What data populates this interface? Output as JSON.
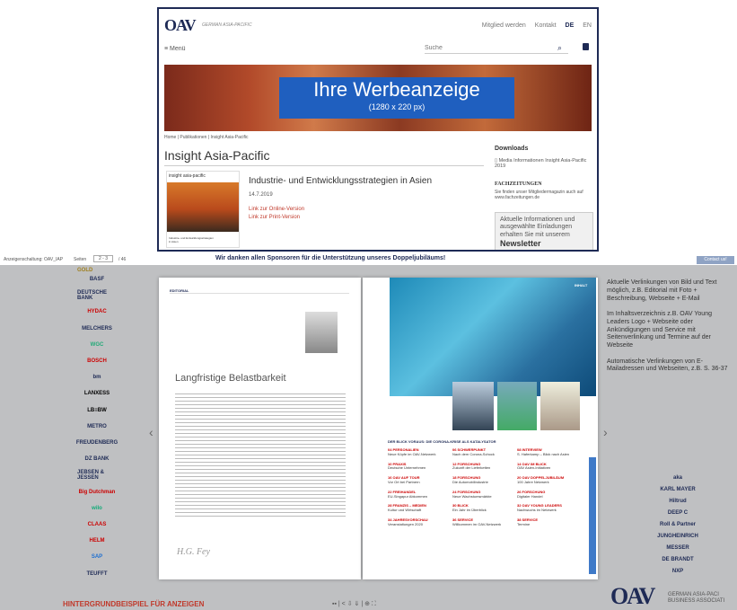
{
  "site": {
    "logo_text": "OAV",
    "logo_sub": "GERMAN ASIA-PACIFIC",
    "nav": [
      "Mitglied werden",
      "Kontakt",
      "DE",
      "EN"
    ],
    "menu_label": "Menü",
    "search_placeholder": "Suche",
    "banner_title": "Ihre Werbeanzeige",
    "banner_size": "(1280 x 220 px)",
    "breadcrumb": "Home | Publikationen | Insight Asia-Pacific",
    "page_title": "Insight Asia-Pacific",
    "cover_label": "insight asia-pacific",
    "cover_caption": "Industrie- und Entwicklungsstrategien in Asien",
    "article_title": "Industrie- und Entwicklungsstrategien in Asien",
    "article_date": "14.7.2019",
    "link_online": "Link zur Online-Version",
    "link_print": "Link zur Print-Version",
    "downloads_title": "Downloads",
    "download_item": "Media Informationen Insight Asia-Pacific 2019",
    "fach_logo": "FACHZEITUNGEN",
    "fach_text": "Sie finden unser Mitgliedermagazin auch auf www.fachzeitungen.de",
    "newsletter_text": "Aktuelle Informationen und ausgewählte Einladungen erhalten Sie mit unserem",
    "newsletter_title": "Newsletter"
  },
  "viewer": {
    "left_label": "Anzeigenschaltung: OAV_IAP",
    "pages_label": "Seiten",
    "page_current": "2 - 3",
    "page_total": "/ 46",
    "thanks": "Wir danken allen Sponsoren für die Unterstützung unseres Doppeljubiläums!",
    "contact_button": "Contact us!",
    "gold_label": "GOLD",
    "sponsors_left": [
      "BASF",
      "DEUTSCHE BANK",
      "HYDAC",
      "MELCHERS",
      "WGC",
      "BOSCH",
      "bm",
      "LANXESS",
      "LB≡BW",
      "METRO",
      "FREUDENBERG",
      "DZ BANK",
      "JEBSEN & JESSEN",
      "Big Dutchman",
      "wilo",
      "CLAAS",
      "HELM",
      "SAP",
      "TEUFFT"
    ],
    "sponsors_right": [
      "aka",
      "KARL MAYER",
      "Hiltrud",
      "DEEP C",
      "Roll & Partner",
      "JUNGHEINRICH",
      "MESSER",
      "DE BRANDT",
      "NXP"
    ],
    "editorial_label": "EDITORIAL",
    "editorial_title": "Langfristige Belastbarkeit",
    "inhalt_label": "INHALT",
    "toc_headline": "DER BLICK VORAUS: DIE CORONA-KRISE ALS KATALYSATOR",
    "toc": [
      [
        "04 PERSONALIEN",
        "Neue Köpfe im OAV-Netzwerk"
      ],
      [
        "06 SCHWERPUNKT",
        "Nach dem Corona-Schock"
      ],
      [
        "08 INTERVIEW",
        "S. Haferkamp – Blick nach Asien"
      ],
      [
        "10 PRAXIS",
        "Deutsche Unternehmen"
      ],
      [
        "12 FORSCHUNG",
        "Zukunft der Lieferketten"
      ],
      [
        "14 OAV IM BLICK",
        "OAV Asien-Initiativen"
      ],
      [
        "16 OAV AUF TOUR",
        "Vor Ort bei Partnern"
      ],
      [
        "18 FORSCHUNG",
        "Die Automobilindustrie"
      ],
      [
        "20 OAV DOPPELJUBILÄUM",
        "100 Jahre Netzwerk"
      ],
      [
        "22 FREIHANDEL",
        "EU-Singapur Abkommen"
      ],
      [
        "24 FORSCHUNG",
        "Neue Wachstumsmärkte"
      ],
      [
        "26 FORSCHUNG",
        "Digitaler Handel"
      ],
      [
        "28 FRANZIS – MEDIEN",
        "Kultur und Wirtschaft"
      ],
      [
        "30 BLICK",
        "Ein Jahr im Überblick"
      ],
      [
        "32 OAV YOUNG LEADERS",
        "Nachwuchs im Netzwerk"
      ],
      [
        "34 JAHRESVORSCHAU",
        "Veranstaltungen 2020"
      ],
      [
        "36 SERVICE",
        "Willkommen im OAV-Netzwerk"
      ],
      [
        "38 SERVICE",
        "Termine"
      ]
    ],
    "right_notes": "Aktuelle Verlinkungen von Bild und Text möglich, z.B. Editorial mit Foto + Beschreibung, Webseite + E-Mail\n\nIm Inhaltsverzeichnis z.B. OAV Young Leaders Logo + Webseite oder Ankündigungen und Service mit Seitenverlinkung und Termine auf der Webseite\n\nAutomatische Verlinkungen von E-Mailadressen und Webseiten, z.B. S. 36-37",
    "bottom_label": "HINTERGRUNDBEISPIEL FÜR ANZEIGEN",
    "bottom_icons": "▪▪ | < ⇩ ⇓ | ⊕ ⛶",
    "brand_big": "OAV",
    "brand_line1": "GERMAN ASIA-PACI",
    "brand_line2": "BUSINESS ASSOCIATI"
  },
  "colors": {
    "navy": "#1e2a55",
    "accent_blue": "#1f5fbf",
    "red": "#c0392b",
    "contact_btn": "#8fa3c4"
  }
}
